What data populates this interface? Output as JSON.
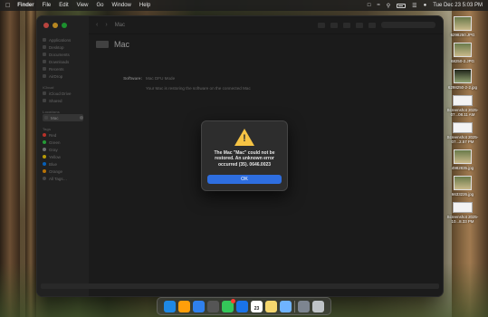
{
  "menubar": {
    "apple_icon": "apple-logo",
    "app_name": "Finder",
    "menus": [
      "File",
      "Edit",
      "View",
      "Go",
      "Window",
      "Help"
    ],
    "datetime": "Tue Dec 23  5:03 PM"
  },
  "finder": {
    "toolbar_title": "Mac",
    "device_name": "Mac",
    "sidebar": {
      "favorites": [
        "Applications",
        "Desktop",
        "Documents",
        "Downloads",
        "Recents",
        "AirDrop"
      ],
      "icloud_header": "iCloud",
      "icloud": [
        "iCloud Drive",
        "Shared"
      ],
      "locations_header": "Locations",
      "locations_selected": "Mac",
      "tags_header": "Tags",
      "tags": [
        {
          "label": "Red",
          "color": "#ff453a"
        },
        {
          "label": "Green",
          "color": "#32d74b"
        },
        {
          "label": "Gray",
          "color": "#98989d"
        },
        {
          "label": "Yellow",
          "color": "#ffd60a"
        },
        {
          "label": "Blue",
          "color": "#0a84ff"
        },
        {
          "label": "Orange",
          "color": "#ff9f0a"
        },
        {
          "label": "All Tags…",
          "color": "#636366"
        }
      ]
    },
    "info": {
      "software_label": "Software:",
      "software_value": "Mac DFU Mode",
      "status": "Your Mac is restoring the software on the connected Mac"
    }
  },
  "alert": {
    "icon": "warning-icon",
    "message": "The Mac \"Mac\" could not be restored. An unknown error occurred (35). 0646.0023",
    "ok_label": "OK",
    "accent": "#2e6ee0"
  },
  "desktop_files": [
    {
      "label": "6298250.JPG",
      "kind": "photo"
    },
    {
      "label": "68250-2.JPG",
      "kind": "photo"
    },
    {
      "label": "6298250-2-2.jpg",
      "kind": "photo"
    },
    {
      "label": "Screenshot 2025-07...08.11 AM",
      "kind": "screenshot"
    },
    {
      "label": "Screenshot 2025-07...2.57 PM",
      "kind": "screenshot"
    },
    {
      "label": "4982835.jpg",
      "kind": "photo"
    },
    {
      "label": "6633226.jpg",
      "kind": "photo"
    },
    {
      "label": "Screenshot 2025-10...8.33 PM",
      "kind": "screenshot"
    }
  ],
  "dock": {
    "apps": [
      {
        "name": "finder",
        "color": "#1e88e5"
      },
      {
        "name": "launchpad",
        "color": "#ff9f0a"
      },
      {
        "name": "safari",
        "color": "#2f80ed"
      },
      {
        "name": "calculator",
        "color": "#555555"
      },
      {
        "name": "messages",
        "color": "#34c759",
        "badge": true
      },
      {
        "name": "mail",
        "color": "#1a73e8"
      },
      {
        "name": "calendar",
        "color": "#ffffff",
        "day": "23"
      },
      {
        "name": "notes",
        "color": "#f5d76e"
      },
      {
        "name": "preview",
        "color": "#6fb3ff"
      }
    ],
    "trailing": [
      {
        "name": "downloads-folder",
        "color": "#7d8590"
      },
      {
        "name": "trash",
        "color": "#bfc3c7"
      }
    ]
  }
}
